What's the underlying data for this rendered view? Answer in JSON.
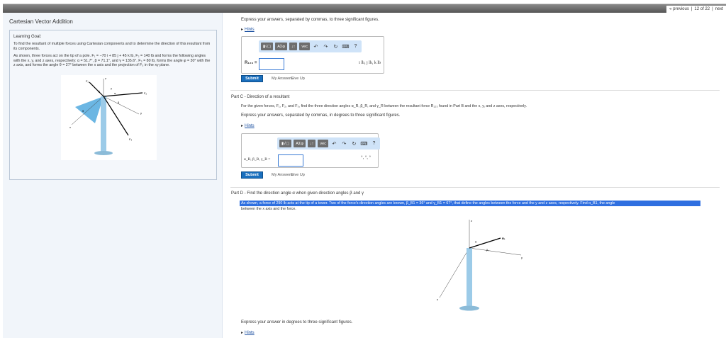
{
  "nav": {
    "previous": "« previous",
    "position": "12 of 22",
    "next": "next"
  },
  "left": {
    "title": "Cartesian Vector Addition",
    "goal_heading": "Learning Goal:",
    "goal_text": "To find the resultant of multiple forces using Cartesian components and to determine the direction of this resultant from its components.",
    "problem_text": "As shown, three forces act on the tip of a pole. F₁ = −70 i + 85 j + 45 k lb, F₂ = 140 lb and forms the following angles with the x, y, and z axes, respectively: α = 51.7°, β = 71.1°, and γ = 135.6°. F₃ = 80 lb, forms the angle φ = 30° with the z axis, and forms the angle θ = 27° between the x axis and the projection of F₃ in the xy plane.",
    "fig": {
      "z": "z",
      "y": "y",
      "x": "x",
      "F1": "F₁",
      "F2": "F₂",
      "F3": "F₃",
      "phi": "φ",
      "theta": "θ",
      "alpha": "α",
      "beta": "β",
      "gamma": "γ"
    }
  },
  "partB": {
    "instruction": "Express your answers, separated by commas, to three significant figures.",
    "hints": "Hints",
    "toolbar": [
      "▮√▢",
      "ΑΣφ",
      "↓↑",
      "vec",
      "↶",
      "↷",
      "↻",
      "⌨",
      "?"
    ],
    "label": "R₁₂₃ =",
    "units": "i lb, j lb, k lb",
    "submit": "Submit",
    "my_answers": "My Answers",
    "give_up": "Give Up"
  },
  "partC": {
    "title": "Part C - Direction of a resultant",
    "text": "For the given forces, F₁, F₂, and F₃, find the three direction angles α_R, β_R, and γ_R between the resultant force R₁₂₃ found in Part B and the x, y, and z axes, respectively.",
    "instruction": "Express your answers, separated by commas, in degrees to three significant figures.",
    "hints": "Hints",
    "toolbar": [
      "▮√▢",
      "ΑΣφ",
      "↓↑",
      "vec",
      "↶",
      "↷",
      "↻",
      "⌨",
      "?"
    ],
    "label": "α_R, β_R, γ_R =",
    "units": "°, °, °",
    "submit": "Submit",
    "my_answers": "My Answers",
    "give_up": "Give Up"
  },
  "partD": {
    "title": "Part D - Find the direction angle α when given direction angles β and γ",
    "text": "As shown, a force of 290 lb acts at the tip of a tower. Two of the force's direction angles are known, β_B1 = 36° and γ_B1 = 67°, that define the angles between the force and the y and z axes, respectively. Find α_B1, the angle",
    "text2": "between the x axis and the force.",
    "fig": {
      "z": "z",
      "y": "y",
      "x": "x",
      "R": "R₁",
      "beta": "β₁",
      "gamma": "γ₁"
    },
    "instruction": "Express your answer in degrees to three significant figures.",
    "hints": "Hints"
  },
  "colors": {
    "accent": "#1a6fbd",
    "highlight": "#2f6fe0"
  }
}
